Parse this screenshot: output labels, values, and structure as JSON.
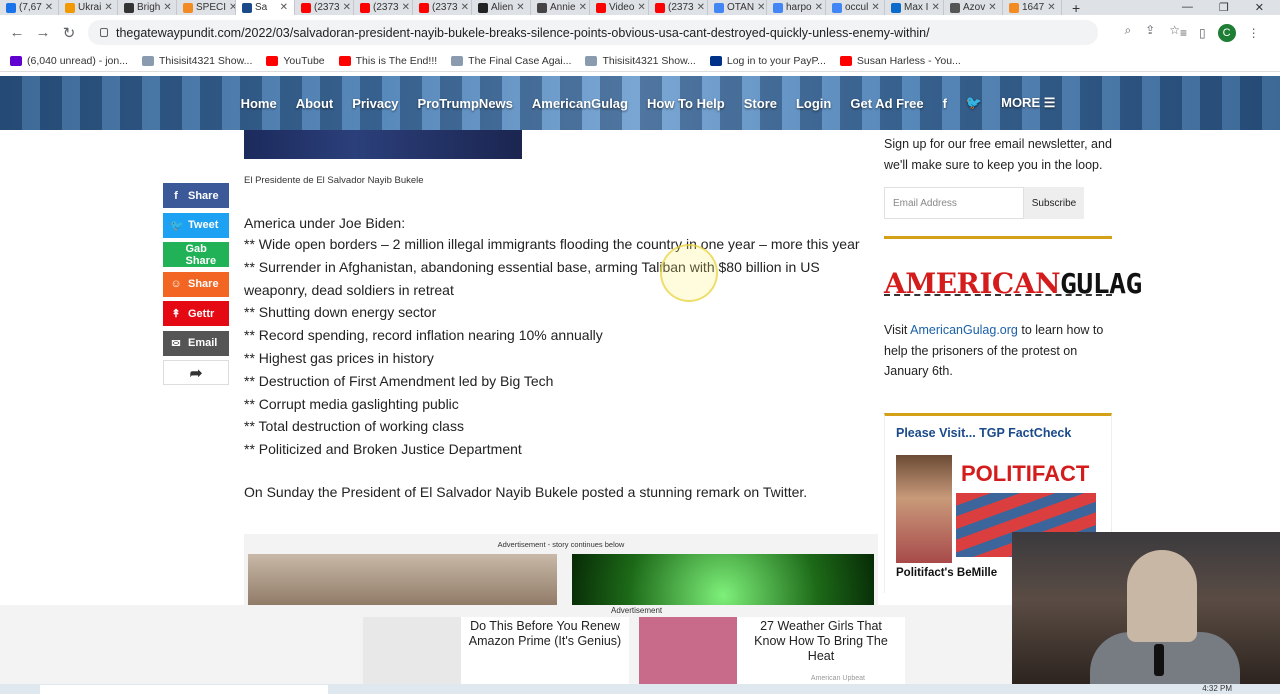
{
  "browser": {
    "tabs": [
      {
        "title": "(7,67",
        "color": "#1a73e8"
      },
      {
        "title": "Ukrai",
        "color": "#f29900"
      },
      {
        "title": "Brigh",
        "color": "#333333"
      },
      {
        "title": "SPECI",
        "color": "#f28b24"
      },
      {
        "title": "Sa",
        "color": "#1a4a8a",
        "active": true
      },
      {
        "title": "(2373",
        "color": "#ff0000"
      },
      {
        "title": "(2373",
        "color": "#ff0000"
      },
      {
        "title": "(2373",
        "color": "#ff0000"
      },
      {
        "title": "Alien",
        "color": "#222222"
      },
      {
        "title": "Annie",
        "color": "#444444"
      },
      {
        "title": "Video",
        "color": "#ff0000"
      },
      {
        "title": "(2373",
        "color": "#ff0000"
      },
      {
        "title": "OTAN",
        "color": "#4285f4"
      },
      {
        "title": "harpo",
        "color": "#4285f4"
      },
      {
        "title": "occul",
        "color": "#4285f4"
      },
      {
        "title": "Max I",
        "color": "#0b6bcb"
      },
      {
        "title": "Azov",
        "color": "#555555"
      },
      {
        "title": "1647",
        "color": "#f28b24"
      }
    ],
    "new_tab": "+",
    "url": "thegatewaypundit.com/2022/03/salvadoran-president-nayib-bukele-breaks-silence-points-obvious-usa-cant-destroyed-quickly-unless-enemy-within/",
    "profile_initial": "C",
    "bookmarks": [
      {
        "label": "(6,040 unread) - jon...",
        "color": "#5f01d1"
      },
      {
        "label": "Thisisit4321 Show...",
        "color": "#8a9bb0"
      },
      {
        "label": "YouTube",
        "color": "#ff0000"
      },
      {
        "label": "This is The End!!!",
        "color": "#ff0000"
      },
      {
        "label": "The Final Case Agai...",
        "color": "#8a9bb0"
      },
      {
        "label": "Thisisit4321 Show...",
        "color": "#8a9bb0"
      },
      {
        "label": "Log in to your PayP...",
        "color": "#003087"
      },
      {
        "label": "Susan Harless - You...",
        "color": "#ff0000"
      }
    ]
  },
  "site_nav": {
    "items": [
      "Home",
      "About",
      "Privacy",
      "ProTrumpNews",
      "AmericanGulag",
      "How To Help",
      "Store",
      "Login",
      "Get Ad Free"
    ],
    "facebook_icon": "f",
    "twitter_icon": "🐦",
    "more_label": "MORE ☰"
  },
  "share": {
    "buttons": [
      {
        "label": "Share",
        "icon": "f",
        "name": "facebook-share-button",
        "cls": "s-fb"
      },
      {
        "label": "Tweet",
        "icon": "🐦",
        "name": "twitter-share-button",
        "cls": "s-tw"
      },
      {
        "label": "Gab Share",
        "icon": "",
        "name": "gab-share-button",
        "cls": "s-gab"
      },
      {
        "label": "Share",
        "icon": "☺",
        "name": "mewe-share-button",
        "cls": "s-mewe"
      },
      {
        "label": "Gettr",
        "icon": "↟",
        "name": "gettr-share-button",
        "cls": "s-gettr"
      },
      {
        "label": "Email",
        "icon": "✉",
        "name": "email-share-button",
        "cls": "s-email"
      }
    ],
    "more_icon": "➦"
  },
  "article": {
    "image_caption": "El Presidente de El Salvador Nayib Bukele",
    "intro": "America under Joe Biden:",
    "bullets": [
      "** Wide open borders – 2 million illegal immigrants flooding the country in one year – more this year",
      "** Surrender in Afghanistan, abandoning essential base, arming Taliban with $80 billion in US weaponry, dead soldiers in retreat",
      "** Shutting down energy sector",
      "** Record spending, record inflation nearing 10% annually",
      "** Highest gas prices in history",
      "** Destruction of First Amendment led by Big Tech",
      "** Corrupt media gaslighting public",
      "** Total destruction of working class",
      "** Politicized and Broken Justice Department"
    ],
    "paragraph": "On Sunday the President of El Salvador Nayib Bukele posted a stunning remark on Twitter.",
    "ad_label": "Advertisement - story continues below"
  },
  "sidebar": {
    "newsletter_text": "Sign up for our free email newsletter, and we'll make sure to keep you in the loop.",
    "email_placeholder": "Email Address",
    "subscribe_label": "Subscribe",
    "gulag_logo_red": "AMERICAN",
    "gulag_logo_black": "GULAG",
    "gulag_text_pre": "Visit ",
    "gulag_link": "AmericanGulag.org",
    "gulag_text_post": " to learn how to help the prisoners of the protest on January 6th.",
    "factcheck_title": "Please Visit... TGP FactCheck",
    "factcheck_logo": "POLITIFACT",
    "factcheck_caption": "Politifact's BeMille"
  },
  "bottom_ad": {
    "label": "Advertisement",
    "cards": [
      {
        "text": "Do This Before You Renew Amazon Prime (It's Genius)",
        "img_color": "#e8e8e8"
      },
      {
        "text": "27 Weather Girls That Know How To Bring The Heat",
        "img_color": "#c86b8a"
      }
    ],
    "sponsor": "American Upbeat"
  },
  "taskbar": {
    "clock": "4:32 PM"
  }
}
